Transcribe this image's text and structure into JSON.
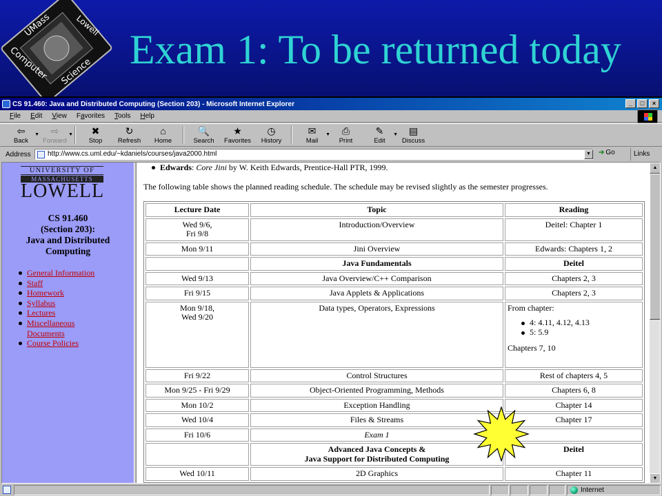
{
  "slide": {
    "title": "Exam 1: To be returned today",
    "logo": {
      "top": "UMass",
      "right": "Lowell",
      "left": "Computer",
      "bottom": "Science"
    }
  },
  "window": {
    "title": "CS 91.460: Java and Distributed Computing (Section 203) - Microsoft Internet Explorer",
    "controls": [
      "_",
      "□",
      "×"
    ]
  },
  "menu": [
    "File",
    "Edit",
    "View",
    "Favorites",
    "Tools",
    "Help"
  ],
  "menu_underline": [
    "F",
    "E",
    "V",
    "a",
    "T",
    "H"
  ],
  "toolbar": [
    {
      "label": "Back",
      "icon": "back-arrow-icon",
      "glyph": "⇦"
    },
    {
      "label": "Forward",
      "icon": "forward-arrow-icon",
      "glyph": "⇨"
    },
    {
      "label": "Stop",
      "icon": "stop-icon",
      "glyph": "✖"
    },
    {
      "label": "Refresh",
      "icon": "refresh-icon",
      "glyph": "↻"
    },
    {
      "label": "Home",
      "icon": "home-icon",
      "glyph": "⌂"
    },
    {
      "label": "Search",
      "icon": "search-icon",
      "glyph": "🔍"
    },
    {
      "label": "Favorites",
      "icon": "favorites-icon",
      "glyph": "★"
    },
    {
      "label": "History",
      "icon": "history-icon",
      "glyph": "◷"
    },
    {
      "label": "Mail",
      "icon": "mail-icon",
      "glyph": "✉"
    },
    {
      "label": "Print",
      "icon": "print-icon",
      "glyph": "⎙"
    },
    {
      "label": "Edit",
      "icon": "edit-icon",
      "glyph": "✎"
    },
    {
      "label": "Discuss",
      "icon": "discuss-icon",
      "glyph": "▤"
    }
  ],
  "address": {
    "label": "Address",
    "url": "http://www.cs.uml.edu/~kdaniels/courses/java2000.html",
    "go": "Go",
    "links": "Links"
  },
  "sidebar": {
    "uni_line": "UNIVERSITY OF",
    "mass_line": "MASSACHUSETTS",
    "lowell_line": "LOWELL",
    "course_lines": [
      "CS 91.460",
      "(Section 203):",
      "Java and Distributed",
      "Computing"
    ],
    "links": [
      "General Information",
      "Staff",
      "Homework",
      "Syllabus",
      "Lectures",
      "Miscellaneous",
      "Documents",
      "Course Policies"
    ]
  },
  "main": {
    "ref_author": "Edwards",
    "ref_sep": ": ",
    "ref_title": "Core Jini",
    "ref_rest": " by W. Keith Edwards, Prentice-Hall PTR, 1999.",
    "intro": "The following table shows the planned reading schedule. The schedule may be revised slightly as the semester progresses.",
    "headers": [
      "Lecture Date",
      "Topic",
      "Reading"
    ],
    "rows": [
      {
        "date": "Wed 9/6,\nFri 9/8",
        "topic": "Introduction/Overview",
        "reading": "Deitel: Chapter 1"
      },
      {
        "date": "Mon 9/11",
        "topic": "Jini Overview",
        "reading": "Edwards: Chapters 1, 2"
      },
      {
        "date": "",
        "topic": "Java Fundamentals",
        "reading": "Deitel",
        "kind": "section"
      },
      {
        "date": "Wed 9/13",
        "topic": "Java Overview/C++ Comparison",
        "reading": "Chapters 2, 3"
      },
      {
        "date": "Fri 9/15",
        "topic": "Java Applets & Applications",
        "reading": "Chapters 2, 3"
      },
      {
        "date": "Mon 9/18,\nWed 9/20",
        "topic": "Data types, Operators, Expressions",
        "kind": "list",
        "reading_pre": "From chapter:",
        "reading_list": [
          "4: 4.11, 4.12, 4.13",
          "5: 5.9"
        ],
        "reading_post": "Chapters 7, 10"
      },
      {
        "date": "Fri 9/22",
        "topic": "Control Structures",
        "reading": "Rest of chapters 4, 5"
      },
      {
        "date": "Mon 9/25 - Fri 9/29",
        "topic": "Object-Oriented Programming, Methods",
        "reading": "Chapters 6, 8"
      },
      {
        "date": "Mon 10/2",
        "topic": "Exception Handling",
        "reading": "Chapter 14"
      },
      {
        "date": "Wed 10/4",
        "topic": "Files & Streams",
        "reading": "Chapter 17"
      },
      {
        "date": "Fri 10/6",
        "topic": "Exam 1",
        "reading": "",
        "kind": "exam"
      },
      {
        "date": "",
        "topic": "Advanced Java Concepts &\nJava Support for Distributed Computing",
        "reading": "Deitel",
        "kind": "section"
      },
      {
        "date": "Wed 10/11",
        "topic": "2D Graphics",
        "reading": "Chapter 11"
      }
    ]
  },
  "status": {
    "zone": "Internet"
  },
  "colors": {
    "slide_bg": "#0a158c",
    "title": "#2fd3d3",
    "sidebar_bg": "#9b9bf8",
    "link": "#c00000",
    "starburst": "#ffff33"
  }
}
